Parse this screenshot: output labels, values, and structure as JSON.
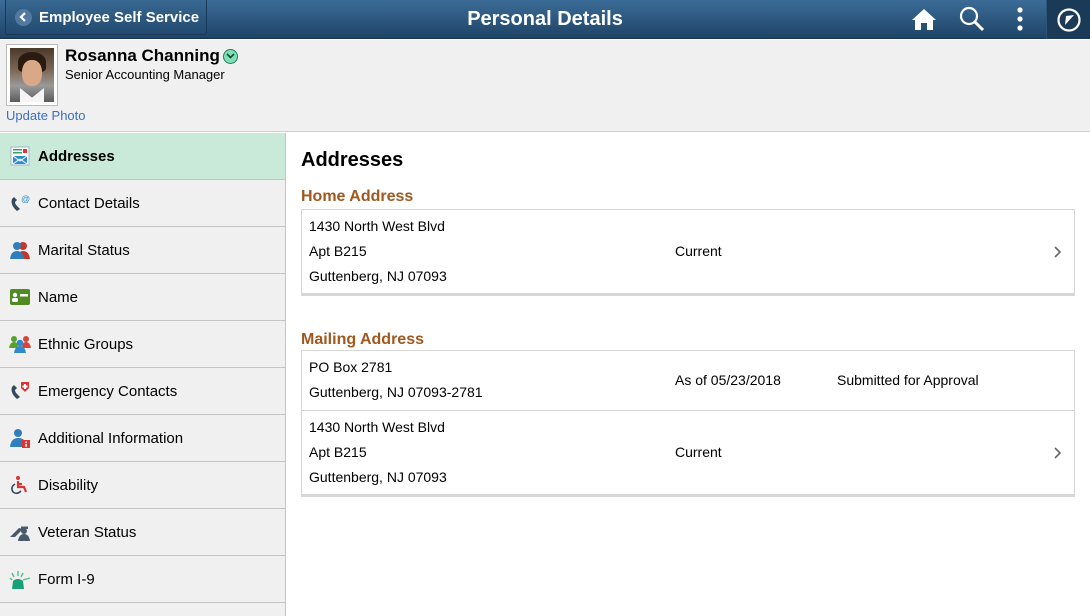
{
  "header": {
    "back_label": "Employee Self Service",
    "title": "Personal Details",
    "icons": [
      "home-icon",
      "search-icon",
      "actions-menu-icon",
      "navbar-compass-icon"
    ]
  },
  "profile": {
    "name": "Rosanna Channing",
    "job_title": "Senior Accounting Manager",
    "update_photo": "Update Photo"
  },
  "sidebar": {
    "items": [
      {
        "label": "Addresses",
        "icon": "addresses-icon",
        "active": true
      },
      {
        "label": "Contact Details",
        "icon": "contact-details-icon"
      },
      {
        "label": "Marital Status",
        "icon": "marital-status-icon"
      },
      {
        "label": "Name",
        "icon": "name-card-icon"
      },
      {
        "label": "Ethnic Groups",
        "icon": "ethnic-groups-icon"
      },
      {
        "label": "Emergency Contacts",
        "icon": "emergency-contacts-icon"
      },
      {
        "label": "Additional Information",
        "icon": "additional-info-icon"
      },
      {
        "label": "Disability",
        "icon": "disability-icon"
      },
      {
        "label": "Veteran Status",
        "icon": "veteran-status-icon"
      },
      {
        "label": "Form I-9",
        "icon": "form-i9-icon"
      }
    ]
  },
  "main": {
    "title": "Addresses",
    "home": {
      "title": "Home Address",
      "rows": [
        {
          "lines": [
            "1430 North West Blvd",
            "Apt B215",
            "Guttenberg, NJ 07093"
          ],
          "status": "Current",
          "note": ""
        }
      ]
    },
    "mailing": {
      "title": "Mailing Address",
      "rows": [
        {
          "lines": [
            "PO Box 2781",
            "Guttenberg, NJ 07093-2781"
          ],
          "status": "As of 05/23/2018",
          "note": "Submitted for Approval"
        },
        {
          "lines": [
            "1430 North West Blvd",
            "Apt B215",
            "Guttenberg, NJ 07093"
          ],
          "status": "Current",
          "note": ""
        }
      ]
    }
  },
  "colors": {
    "header": "#2b5880",
    "active_item": "#c9ead9",
    "section_title": "#a0581f",
    "link": "#3a6fbf"
  }
}
